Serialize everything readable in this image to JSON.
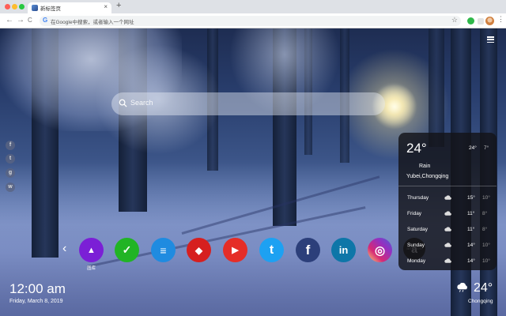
{
  "browser": {
    "tab_title": "新标签页",
    "tab_close": "×",
    "new_tab": "+",
    "omnibox_text": "在Google中搜索，或者输入一个网址",
    "back": "←",
    "forward": "→",
    "reload": "C",
    "google_glyph": "G",
    "star": "☆",
    "menu": "⋮",
    "colors": {
      "close": "#ff5f57",
      "minimize": "#febc2e",
      "maximize": "#28c840"
    }
  },
  "search": {
    "placeholder": "Search"
  },
  "social_sidebar": [
    {
      "icon": "facebook-icon",
      "glyph": "f"
    },
    {
      "icon": "twitter-icon",
      "glyph": "t"
    },
    {
      "icon": "google-icon",
      "glyph": "g"
    },
    {
      "icon": "wechat-icon",
      "glyph": "w"
    }
  ],
  "apps": [
    {
      "name": "gallery",
      "label": "图库",
      "color": "#7b1fd6",
      "glyph": "▲"
    },
    {
      "name": "tasks",
      "color": "#21b425",
      "glyph": "✓"
    },
    {
      "name": "notes",
      "color": "#1f8be0",
      "glyph": "≡"
    },
    {
      "name": "games",
      "color": "#d61f1f",
      "glyph": "◆"
    },
    {
      "name": "youtube",
      "color": "#e52d27",
      "glyph": "▶"
    },
    {
      "name": "twitter",
      "color": "#1da1f2",
      "glyph": "t"
    },
    {
      "name": "facebook",
      "color": "#2c3f7a",
      "glyph": "f"
    },
    {
      "name": "linkedin",
      "color": "#0e76a8",
      "glyph": "in"
    },
    {
      "name": "instagram",
      "color": "#c13584",
      "glyph": "◎"
    },
    {
      "name": "amazon",
      "label": "amazon",
      "color": "#222222",
      "glyph": "a"
    }
  ],
  "nav_prev": "‹",
  "clock": {
    "time": "12:00 am",
    "date": "Friday, March 8, 2019"
  },
  "weather": {
    "temp": "24°",
    "high": "24°",
    "low": "7°",
    "condition": "Rain",
    "location": "Yubei,Chongqing",
    "forecast": [
      {
        "day": "Thursday",
        "high": "15°",
        "low": "10°",
        "icon": "cloud-icon"
      },
      {
        "day": "Friday",
        "high": "11°",
        "low": "8°",
        "icon": "cloud-icon"
      },
      {
        "day": "Saturday",
        "high": "11°",
        "low": "8°",
        "icon": "cloud-icon"
      },
      {
        "day": "Sunday",
        "high": "14°",
        "low": "10°",
        "icon": "cloud-icon"
      },
      {
        "day": "Monday",
        "high": "14°",
        "low": "10°",
        "icon": "cloud-icon"
      }
    ],
    "mini_temp": "24°",
    "mini_city": "Chongqing"
  }
}
